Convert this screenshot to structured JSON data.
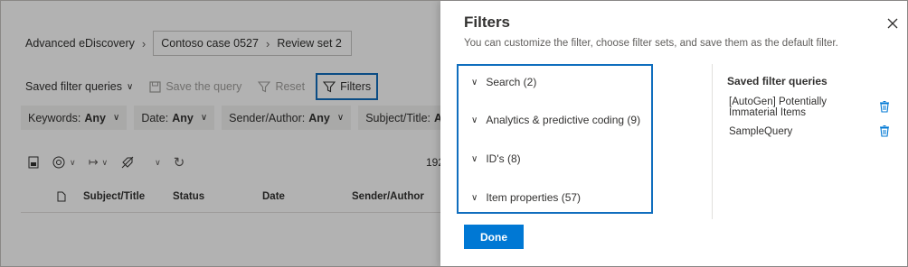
{
  "breadcrumb": {
    "root": "Advanced eDiscovery",
    "case": "Contoso case 0527",
    "review_set": "Review set 2"
  },
  "toolbar": {
    "saved_filter_queries": "Saved filter queries",
    "save_query": "Save the query",
    "reset": "Reset",
    "filters": "Filters"
  },
  "filter_pills": [
    {
      "label": "Keywords:",
      "value": "Any"
    },
    {
      "label": "Date:",
      "value": "Any"
    },
    {
      "label": "Sender/Author:",
      "value": "Any"
    },
    {
      "label": "Subject/Title:",
      "value": "A"
    }
  ],
  "results": {
    "count_fragment": "192"
  },
  "table": {
    "columns": [
      "Subject/Title",
      "Status",
      "Date",
      "Sender/Author"
    ]
  },
  "panel": {
    "title": "Filters",
    "subtitle": "You can customize the filter, choose filter sets, and save them as the default filter.",
    "groups": [
      "Search (2)",
      "Analytics & predictive coding (9)",
      "ID's (8)",
      "Item properties (57)"
    ],
    "saved_heading": "Saved filter queries",
    "saved_queries": [
      {
        "line1": "[AutoGen] Potentially",
        "line2": "Immaterial Items"
      },
      {
        "line1": "SampleQuery",
        "line2": ""
      }
    ],
    "done_label": "Done"
  },
  "colors": {
    "accent": "#0078d4",
    "focus_border": "#106ebe",
    "overlay": "rgba(0,0,0,0.30)"
  }
}
